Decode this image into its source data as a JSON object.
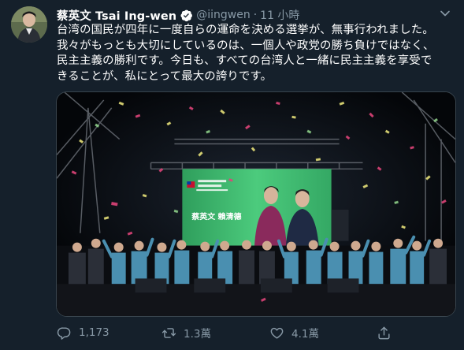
{
  "tweet": {
    "author_name": "蔡英文 Tsai Ing-wen",
    "handle": "@iingwen",
    "separator": "·",
    "time": "11 小時",
    "text": "台湾の国民が四年に一度自らの運命を決める選挙が、無事行われました。\n我々がもっとも大切にしているのは、一個人や政党の勝ち負けではなく、\n民主主義の勝利です。今日も、すべての台湾人と一緒に民主主義を享受で\nきることが、私にとって最大の誇りです。",
    "media_screen_text": "蔡英文 賴清德"
  },
  "actions": {
    "replies": "1,173",
    "retweets": "1.3萬",
    "likes": "4.1萬"
  },
  "colors": {
    "background": "#15202b",
    "secondary_text": "#8899a6",
    "verified_blue": "#1da1f2",
    "stage_screen_green": "#3fbf72"
  },
  "icons": [
    "verified-icon",
    "chevron-down-icon",
    "reply-icon",
    "retweet-icon",
    "like-icon",
    "share-icon"
  ]
}
